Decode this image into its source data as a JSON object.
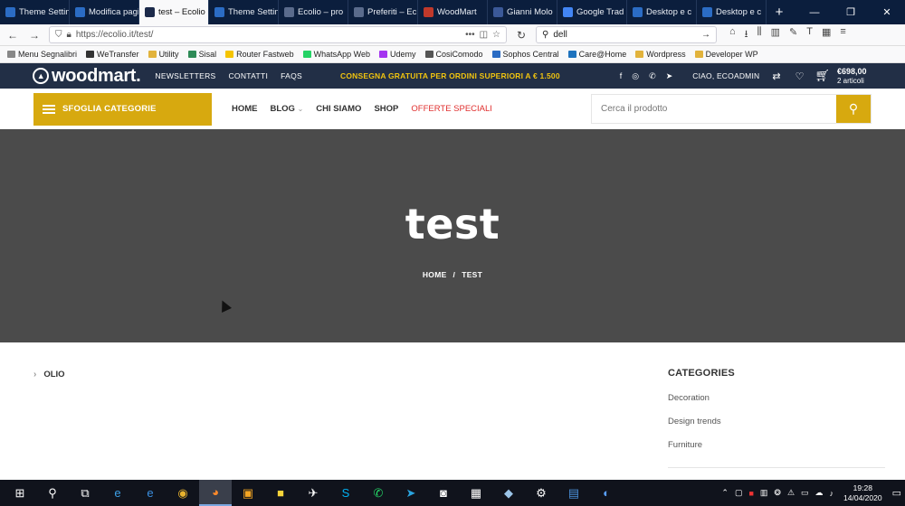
{
  "browser": {
    "tabs": [
      {
        "label": "Theme Settings",
        "color": "#2b6cc4",
        "active": false
      },
      {
        "label": "Modifica pagina",
        "color": "#2b6cc4",
        "active": false
      },
      {
        "label": "test – Ecolio",
        "color": "#ffffff",
        "active": true
      },
      {
        "label": "Theme Settings",
        "color": "#2b6cc4",
        "active": false
      },
      {
        "label": "Ecolio – pro",
        "color": "#1c2a4a",
        "active": false
      },
      {
        "label": "Preferiti – Ec",
        "color": "#1c2a4a",
        "active": false
      },
      {
        "label": "WoodMart",
        "color": "#c0392b",
        "active": false
      },
      {
        "label": "Gianni Molo",
        "color": "#3b5998",
        "active": false
      },
      {
        "label": "Google Trad",
        "color": "#4285f4",
        "active": false
      },
      {
        "label": "Desktop e c",
        "color": "#2b6cc4",
        "active": false
      },
      {
        "label": "Desktop e c",
        "color": "#2b6cc4",
        "active": false
      }
    ],
    "url": "https://ecolio.it/test/",
    "search_value": "dell",
    "bookmarks": [
      {
        "label": "Menu Segnalibri",
        "color": "#888888"
      },
      {
        "label": "WeTransfer",
        "color": "#333333"
      },
      {
        "label": "Utility",
        "color": "#e2b33c"
      },
      {
        "label": "Sisal",
        "color": "#2e8b57"
      },
      {
        "label": "Router Fastweb",
        "color": "#f5c400"
      },
      {
        "label": "WhatsApp Web",
        "color": "#25d366"
      },
      {
        "label": "Udemy",
        "color": "#a435f0"
      },
      {
        "label": "CosiComodo",
        "color": "#555555"
      },
      {
        "label": "Sophos Central",
        "color": "#2b6cc4"
      },
      {
        "label": "Care@Home",
        "color": "#1e73be"
      },
      {
        "label": "Wordpress",
        "color": "#e2b33c"
      },
      {
        "label": "Developer WP",
        "color": "#e2b33c"
      }
    ]
  },
  "site": {
    "logo": "woodmart.",
    "top_links": [
      "NEWSLETTERS",
      "CONTATTI",
      "FAQS"
    ],
    "promo": "CONSEGNA GRATUITA PER ORDINI SUPERIORI A € 1.500",
    "greeting": "CIAO, ECOADMIN",
    "cart_total": "€698,00",
    "cart_count": "2 articoli",
    "categories_button": "SFOGLIA CATEGORIE",
    "nav": [
      "HOME",
      "BLOG",
      "CHI SIAMO",
      "SHOP",
      "OFFERTE SPECIALI"
    ],
    "search_placeholder": "Cerca il prodotto",
    "page_title": "test",
    "breadcrumb": [
      "HOME",
      "/",
      "TEST"
    ],
    "category_item": "OLIO",
    "sidebar_title": "CATEGORIES",
    "sidebar_links": [
      "Decoration",
      "Design trends",
      "Furniture"
    ],
    "accent": "#d7a90f"
  },
  "taskbar": {
    "time": "19:28",
    "date": "14/04/2020"
  }
}
